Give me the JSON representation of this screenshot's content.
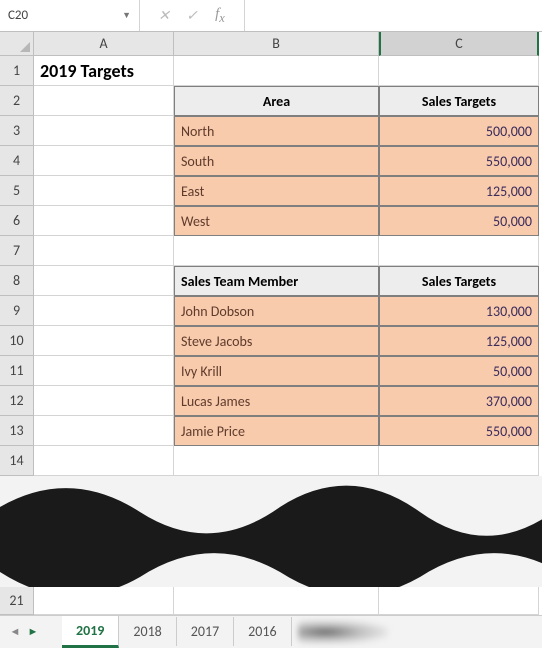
{
  "name_box": "C20",
  "formula_value": "",
  "columns": [
    "A",
    "B",
    "C"
  ],
  "rows_a": [
    "1",
    "2",
    "3",
    "4",
    "5",
    "6",
    "7",
    "8",
    "9",
    "10",
    "11",
    "12",
    "13",
    "14"
  ],
  "row_21": "21",
  "title": "2019 Targets",
  "table1": {
    "h1": "Area",
    "h2": "Sales Targets",
    "rows": [
      {
        "name": "North",
        "val": "500,000"
      },
      {
        "name": "South",
        "val": "550,000"
      },
      {
        "name": "East",
        "val": "125,000"
      },
      {
        "name": "West",
        "val": "50,000"
      }
    ]
  },
  "table2": {
    "h1": "Sales Team Member",
    "h2": "Sales Targets",
    "rows": [
      {
        "name": "John Dobson",
        "val": "130,000"
      },
      {
        "name": "Steve Jacobs",
        "val": "125,000"
      },
      {
        "name": "Ivy Krill",
        "val": "50,000"
      },
      {
        "name": "Lucas James",
        "val": "370,000"
      },
      {
        "name": "Jamie Price",
        "val": "550,000"
      }
    ]
  },
  "tabs": [
    "2019",
    "2018",
    "2017",
    "2016"
  ],
  "active_tab": "2019"
}
